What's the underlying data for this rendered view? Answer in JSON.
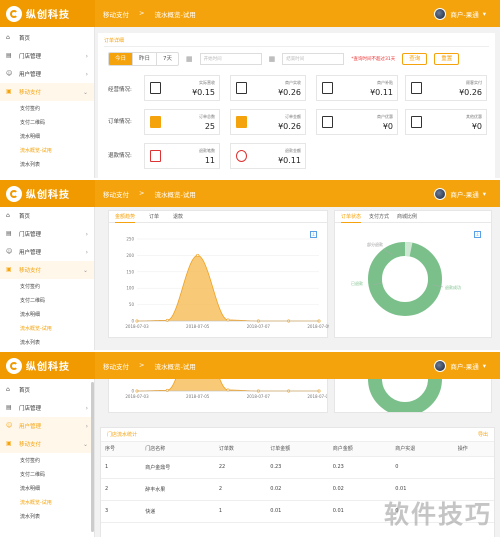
{
  "brand": {
    "name": "纵创科技"
  },
  "breadcrumb": {
    "part1": "移动支付",
    "sep": ">",
    "part2": "流水概览-试用"
  },
  "user": {
    "label": "商户-果通"
  },
  "sidebar": {
    "items": [
      {
        "label": "首页"
      },
      {
        "label": "门店管理"
      },
      {
        "label": "用户管理"
      },
      {
        "label": "移动支付"
      }
    ],
    "subs": [
      {
        "label": "支付签约"
      },
      {
        "label": "支付二维码"
      },
      {
        "label": "流水明细"
      },
      {
        "label": "流水概览-试用"
      },
      {
        "label": "流水列表"
      }
    ]
  },
  "filter": {
    "section_label": "订单详细",
    "seg": [
      "今日",
      "昨日",
      "7天"
    ],
    "start_placeholder": "开始时间",
    "end_placeholder": "结束时间",
    "hint": "*查询时间不超过31天",
    "query": "查询",
    "reset": "重置"
  },
  "rows": {
    "business": "经营情况:",
    "order": "订单情况:",
    "refund": "退款情况:"
  },
  "cards": {
    "business": [
      {
        "label": "实际营收",
        "value": "¥0.15"
      },
      {
        "label": "商户实收",
        "value": "¥0.26"
      },
      {
        "label": "商户补贴",
        "value": "¥0.11"
      },
      {
        "label": "顾客实付",
        "value": "¥0.26"
      }
    ],
    "order": [
      {
        "label": "订单总数",
        "value": "25"
      },
      {
        "label": "订单金额",
        "value": "¥0.26"
      },
      {
        "label": "商户优惠",
        "value": "¥0"
      },
      {
        "label": "其他优惠",
        "value": "¥0"
      }
    ],
    "refund": [
      {
        "label": "退款笔数",
        "value": "11"
      },
      {
        "label": "退款金额",
        "value": "¥0.11"
      }
    ]
  },
  "trend": {
    "tabs": [
      "金额趋势",
      "订单",
      "退款"
    ],
    "yticks": [
      "250",
      "200",
      "150",
      "100",
      "50",
      "0"
    ],
    "xticks": [
      "2018-07-03",
      "2018-07-05",
      "2018-07-07",
      "2018-07-09"
    ],
    "yticks_small": [
      "50",
      "0"
    ]
  },
  "donut": {
    "tabs": [
      "订单状态",
      "支付方式",
      "商城比例"
    ],
    "labels": [
      "部分退款",
      "已退款",
      "退款成功"
    ]
  },
  "store_table": {
    "title": "门店流水统计",
    "export": "导出",
    "headers": [
      "序号",
      "门店名称",
      "订单数",
      "订单金额",
      "商户金额",
      "商户实退",
      "操作"
    ],
    "rows": [
      [
        "1",
        "商户金鼎号",
        "22",
        "0.23",
        "0.23",
        "0",
        ""
      ],
      [
        "2",
        "醉丰水果",
        "2",
        "0.02",
        "0.02",
        "0.01",
        ""
      ],
      [
        "3",
        "快递",
        "1",
        "0.01",
        "0.01",
        "0",
        ""
      ]
    ]
  },
  "watermark": "软件技巧",
  "chart_data": {
    "type": "area",
    "title": "",
    "x": [
      "2018-07-03",
      "2018-07-04",
      "2018-07-05",
      "2018-07-06",
      "2018-07-07",
      "2018-07-08",
      "2018-07-09"
    ],
    "values": [
      0,
      2,
      200,
      3,
      0,
      0,
      0
    ],
    "ylim": [
      0,
      250
    ],
    "color": "#f5b84a"
  }
}
